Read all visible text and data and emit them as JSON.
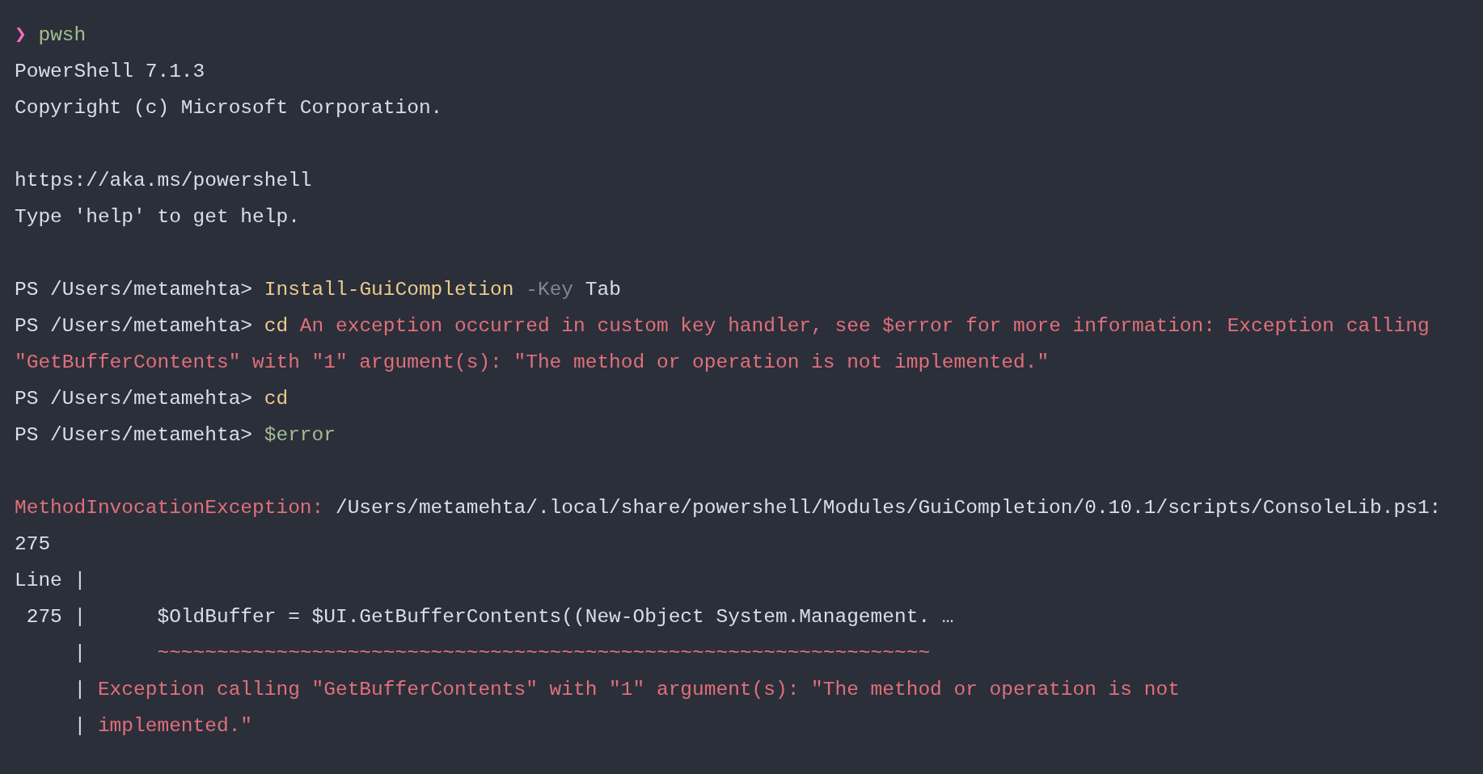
{
  "terminal": {
    "blocks": [
      {
        "lines": [
          {
            "segments": [
              {
                "kind": "symbol",
                "text": "❯ "
              },
              {
                "kind": "shell",
                "text": "pwsh"
              }
            ]
          },
          {
            "segments": [
              {
                "kind": "text",
                "text": "PowerShell 7.1.3"
              }
            ]
          },
          {
            "segments": [
              {
                "kind": "text",
                "text": "Copyright (c) Microsoft Corporation."
              }
            ]
          }
        ]
      },
      {
        "lines": [
          {
            "segments": [
              {
                "kind": "text",
                "text": "https://aka.ms/powershell"
              }
            ]
          },
          {
            "segments": [
              {
                "kind": "text",
                "text": "Type 'help' to get help."
              }
            ]
          }
        ]
      },
      {
        "lines": [
          {
            "segments": [
              {
                "kind": "text",
                "text": "PS /Users/metamehta> "
              },
              {
                "kind": "command",
                "text": "Install-GuiCompletion"
              },
              {
                "kind": "parameter",
                "text": " -Key"
              },
              {
                "kind": "text",
                "text": " Tab"
              }
            ]
          },
          {
            "segments": [
              {
                "kind": "text",
                "text": "PS /Users/metamehta> "
              },
              {
                "kind": "command",
                "text": "cd"
              },
              {
                "kind": "error",
                "text": " An exception occurred in custom key handler, see $error for more information: Exception calling"
              }
            ]
          },
          {
            "segments": [
              {
                "kind": "error",
                "text": "\"GetBufferContents\" with \"1\" argument(s): \"The method or operation is not implemented.\""
              }
            ]
          },
          {
            "segments": [
              {
                "kind": "text",
                "text": "PS /Users/metamehta> "
              },
              {
                "kind": "command",
                "text": "cd"
              }
            ]
          },
          {
            "segments": [
              {
                "kind": "text",
                "text": "PS /Users/metamehta> "
              },
              {
                "kind": "variable",
                "text": "$error"
              }
            ]
          }
        ]
      },
      {
        "lines": [
          {
            "segments": [
              {
                "kind": "error",
                "text": "MethodInvocationException:"
              },
              {
                "kind": "text",
                "text": " /Users/metamehta/.local/share/powershell/Modules/GuiCompletion/0.10.1/scripts/ConsoleLib.ps1:"
              }
            ]
          },
          {
            "segments": [
              {
                "kind": "text",
                "text": "275"
              }
            ]
          },
          {
            "segments": [
              {
                "kind": "text",
                "text": "Line |"
              }
            ]
          },
          {
            "segments": [
              {
                "kind": "text",
                "text": " 275 |"
              },
              {
                "kind": "text",
                "text": "      $OldBuffer = $UI.GetBufferContents((New-Object System.Management. …"
              }
            ]
          },
          {
            "segments": [
              {
                "kind": "text",
                "text": "     |"
              },
              {
                "kind": "error",
                "text": "      ~~~~~~~~~~~~~~~~~~~~~~~~~~~~~~~~~~~~~~~~~~~~~~~~~~~~~~~~~~~~~~~~~"
              }
            ]
          },
          {
            "segments": [
              {
                "kind": "text",
                "text": "     |"
              },
              {
                "kind": "error",
                "text": " Exception calling \"GetBufferContents\" with \"1\" argument(s): \"The method or operation is not"
              }
            ]
          },
          {
            "segments": [
              {
                "kind": "text",
                "text": "     |"
              },
              {
                "kind": "error",
                "text": " implemented.\""
              }
            ]
          }
        ]
      }
    ]
  }
}
